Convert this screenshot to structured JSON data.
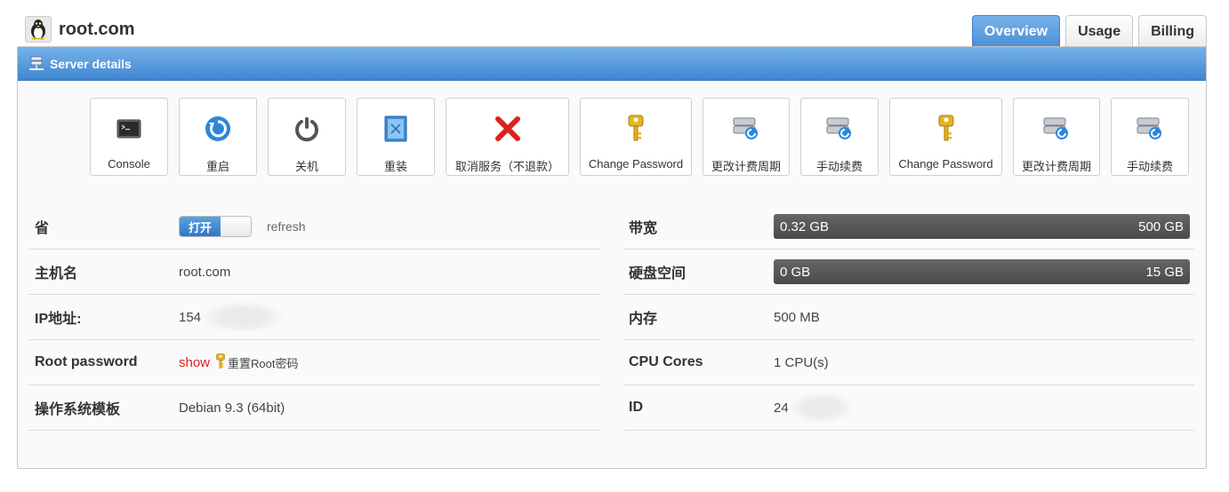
{
  "header": {
    "title": "root.com",
    "os_icon": "tux-penguin-icon"
  },
  "tabs": [
    {
      "label": "Overview",
      "active": true
    },
    {
      "label": "Usage",
      "active": false
    },
    {
      "label": "Billing",
      "active": false
    }
  ],
  "panel": {
    "title": "Server details",
    "icon": "server-network-icon"
  },
  "actions": [
    {
      "label": "Console",
      "icon": "console-icon"
    },
    {
      "label": "重启",
      "icon": "restart-icon"
    },
    {
      "label": "关机",
      "icon": "power-icon"
    },
    {
      "label": "重装",
      "icon": "reinstall-icon"
    },
    {
      "label": "取消服务（不退款）",
      "icon": "cancel-x-icon"
    },
    {
      "label": "Change Password",
      "icon": "key-icon"
    },
    {
      "label": "更改计费周期",
      "icon": "billing-cycle-icon"
    },
    {
      "label": "手动续费",
      "icon": "renew-icon"
    },
    {
      "label": "Change Password",
      "icon": "key-icon"
    },
    {
      "label": "更改计费周期",
      "icon": "billing-cycle-icon"
    },
    {
      "label": "手动续费",
      "icon": "renew-icon"
    }
  ],
  "left_info": {
    "province": {
      "key": "省",
      "toggle_label": "打开",
      "refresh_label": "refresh"
    },
    "hostname": {
      "key": "主机名",
      "value": "root.com"
    },
    "ip": {
      "key": "IP地址:",
      "value": "154"
    },
    "root_password": {
      "key": "Root password",
      "show_label": "show",
      "reset_label": "重置Root密码"
    },
    "os_template": {
      "key": "操作系统模板",
      "value": "Debian 9.3 (64bit)"
    }
  },
  "right_info": {
    "bandwidth": {
      "key": "带宽",
      "used": "0.32 GB",
      "total": "500 GB"
    },
    "disk": {
      "key": "硬盘空间",
      "used": "0 GB",
      "total": "15 GB"
    },
    "memory": {
      "key": "内存",
      "value": "500 MB"
    },
    "cpu": {
      "key": "CPU Cores",
      "value": "1 CPU(s)"
    },
    "id": {
      "key": "ID",
      "value": "24"
    }
  },
  "colors": {
    "accent": "#4a8fd5",
    "bar": "#555555",
    "link_red": "#e02020"
  }
}
